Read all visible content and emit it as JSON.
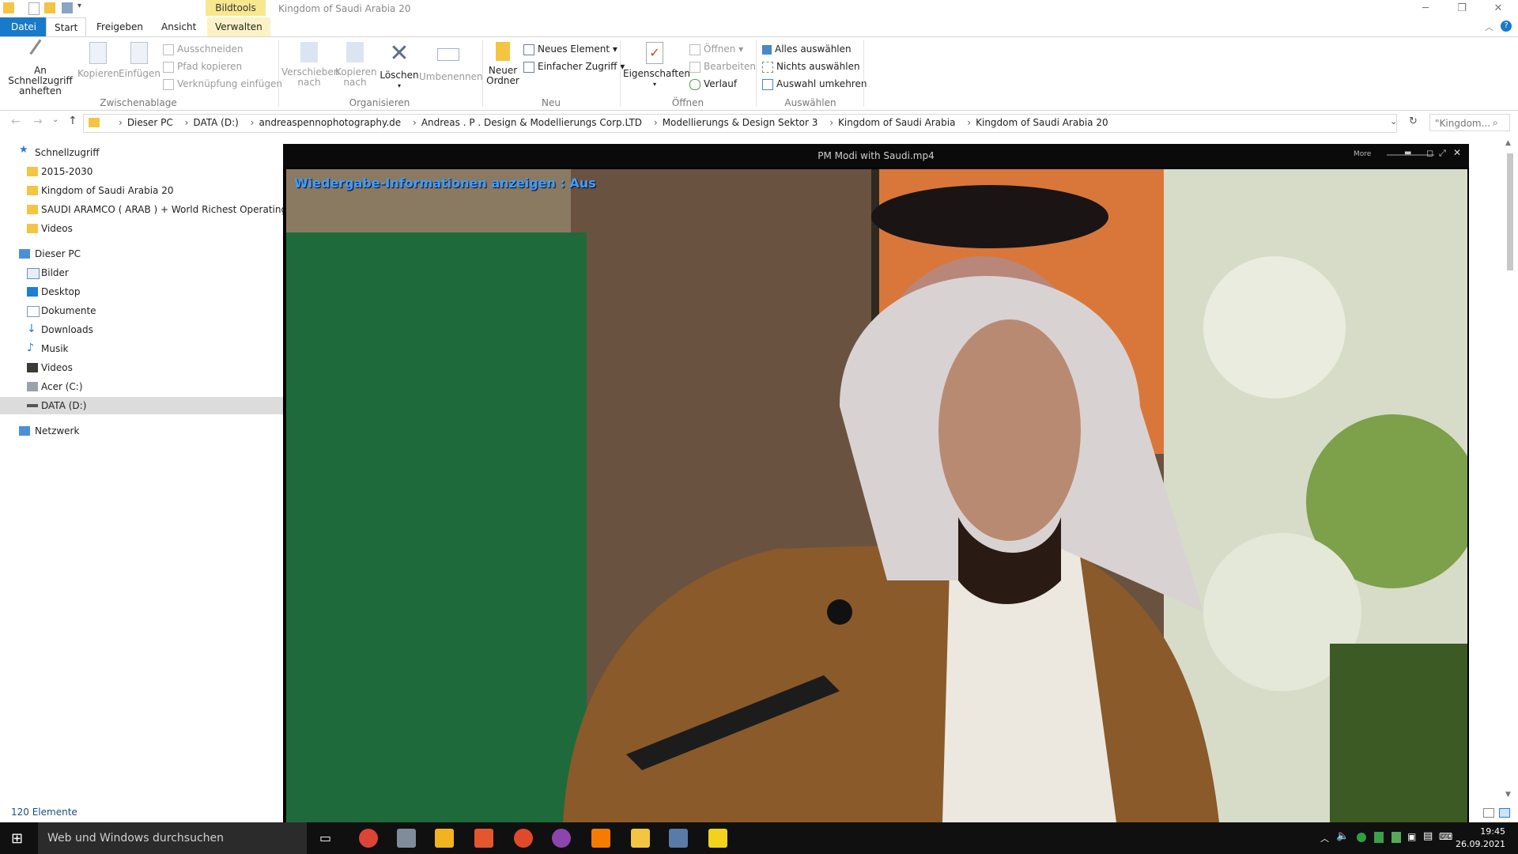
{
  "window": {
    "title": "Kingdom of Saudi Arabia 20",
    "context_tab": "Bildtools"
  },
  "tabs": [
    "Datei",
    "Start",
    "Freigeben",
    "Ansicht",
    "Verwalten"
  ],
  "ribbon": {
    "pin_label": "An Schnellzugriff\nanheften",
    "copy_label": "Kopieren",
    "paste_label": "Einfügen",
    "cut_label": "Ausschneiden",
    "copy_path_label": "Pfad kopieren",
    "paste_shortcut_label": "Verknüpfung einfügen",
    "group_clipboard": "Zwischenablage",
    "move_to_label": "Verschieben\nnach",
    "copy_to_label": "Kopieren\nnach",
    "delete_label": "Löschen",
    "rename_label": "Umbenennen",
    "group_organize": "Organisieren",
    "new_folder_label": "Neuer\nOrdner",
    "new_item_label": "Neues Element",
    "easy_access_label": "Einfacher Zugriff",
    "group_new": "Neu",
    "properties_label": "Eigenschaften",
    "open_label": "Öffnen",
    "edit_label": "Bearbeiten",
    "history_label": "Verlauf",
    "group_open": "Öffnen",
    "select_all_label": "Alles auswählen",
    "select_none_label": "Nichts auswählen",
    "invert_selection_label": "Auswahl umkehren",
    "group_select": "Auswählen"
  },
  "address": {
    "crumbs": [
      "Dieser PC",
      "DATA (D:)",
      "andreaspennophotography.de",
      "Andreas . P . Design & Modellierungs Corp.LTD",
      "Modellierungs & Design Sektor 3",
      "Kingdom of Saudi Arabia",
      "Kingdom of Saudi Arabia 20"
    ],
    "search_placeholder": "\"Kingdom..."
  },
  "nav": {
    "quick_access": "Schnellzugriff",
    "quick_items": [
      "2015-2030",
      "Kingdom of Saudi Arabia 20",
      "SAUDI ARAMCO ( ARAB ) + World Richest Operating Corp",
      "Videos"
    ],
    "this_pc": "Dieser PC",
    "pc_items": [
      "Bilder",
      "Desktop",
      "Dokumente",
      "Downloads",
      "Musik",
      "Videos",
      "Acer (C:)",
      "DATA (D:)"
    ],
    "network": "Netzwerk"
  },
  "video": {
    "title": "PM Modi with Saudi.mp4",
    "more_label": "More",
    "osd": "Wiedergabe-Informationen anzeigen : Aus"
  },
  "status": {
    "count": "120 Elemente"
  },
  "taskbar": {
    "search_placeholder": "Web und Windows durchsuchen",
    "time": "19:45",
    "date": "26.09.2021"
  }
}
